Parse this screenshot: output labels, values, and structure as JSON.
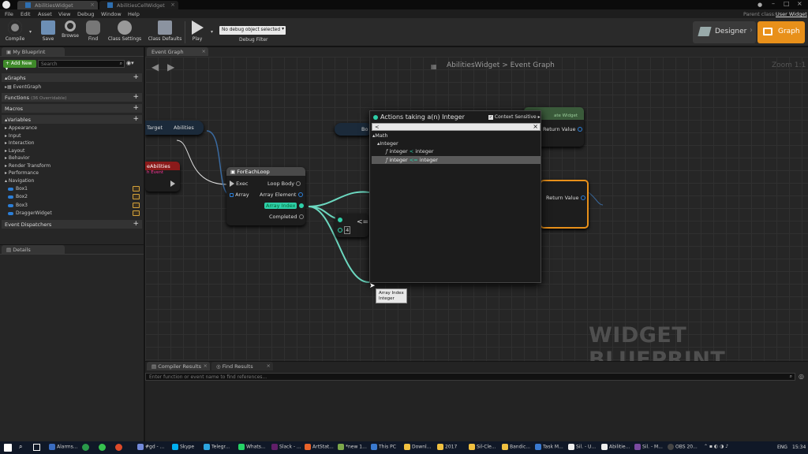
{
  "window": {
    "tabs": [
      "AbilitiesWidget",
      "AbilitiesCellWidget"
    ],
    "parent_class_label": "Parent class:",
    "parent_class_value": "User Widget"
  },
  "menu": [
    "File",
    "Edit",
    "Asset",
    "View",
    "Debug",
    "Window",
    "Help"
  ],
  "toolbar": {
    "compile": "Compile",
    "save": "Save",
    "browse": "Browse",
    "find": "Find",
    "class_settings": "Class Settings",
    "class_defaults": "Class Defaults",
    "play": "Play",
    "debug_select": "No debug object selected",
    "debug_filter": "Debug Filter",
    "designer": "Designer",
    "graph": "Graph"
  },
  "my_blueprint": {
    "tab": "My Blueprint",
    "add_new": "+ Add New",
    "search_placeholder": "Search",
    "graphs": "Graphs",
    "event_graph": "EventGraph",
    "functions": "Functions",
    "functions_note": "(36 Overridable)",
    "macros": "Macros",
    "variables": "Variables",
    "categories": [
      "Appearance",
      "Input",
      "Interaction",
      "Layout",
      "Behavior",
      "Render Transform",
      "Performance",
      "Navigation"
    ],
    "vars": [
      "Box1",
      "Box2",
      "Box3",
      "DraggerWidget"
    ],
    "event_dispatchers": "Event Dispatchers"
  },
  "details": {
    "tab": "Details"
  },
  "graph": {
    "tab": "Event Graph",
    "breadcrumb_root": "AbilitiesWidget",
    "breadcrumb_sep": ">",
    "breadcrumb_leaf": "Event Graph",
    "zoom": "Zoom 1:1",
    "watermark": "WIDGET BLUEPRINT"
  },
  "nodes": {
    "target_pin": "Target",
    "abilities_pin": "Abilities",
    "event_title": "eAbilities",
    "event_sub": "h Event",
    "foreach_title": "ForEachLoop",
    "exec": "Exec",
    "array": "Array",
    "loop_body": "Loop Body",
    "array_element": "Array Element",
    "array_index": "Array Index",
    "completed": "Completed",
    "compare_op": "<=",
    "compare_value": "4",
    "box_label": "Bo",
    "create_sub": "ate Widget",
    "return_value": "Return Value",
    "return_value2": "Return Value"
  },
  "popup": {
    "title": "Actions taking a(n) Integer",
    "context_sensitive": "Context Sensitive",
    "search_value": "<",
    "category": "Math",
    "subcategory": "Integer",
    "items": [
      {
        "left": "integer",
        "op": "<",
        "right": "integer"
      },
      {
        "left": "integer",
        "op": "<=",
        "right": "integer"
      }
    ]
  },
  "tooltip": {
    "line1": "Array Index",
    "line2": "Integer"
  },
  "bottom": {
    "tab1": "Compiler Results",
    "tab2": "Find Results",
    "placeholder": "Enter function or event name to find references..."
  },
  "taskbar": {
    "items": [
      "Alarms...",
      "#gd - ...",
      "Skype",
      "Telegr...",
      "Whats...",
      "Slack - ...",
      "ArtStat...",
      "*new 1...",
      "This PC",
      "Downl...",
      "2017",
      "Sil-Cle...",
      "Bandic...",
      "Task M...",
      "Sil. - U...",
      "Abilitie...",
      "Sil. - M...",
      "OBS 20..."
    ],
    "lang": "ENG",
    "time": "15:34"
  },
  "colors": {
    "accent_orange": "#e8901a",
    "exec_pin": "#bbbbbb",
    "int_pin": "#2ecfa8",
    "object_pin": "#2b7fd9",
    "event_header": "#8b1a1a",
    "function_header": "#3a5a7a"
  }
}
